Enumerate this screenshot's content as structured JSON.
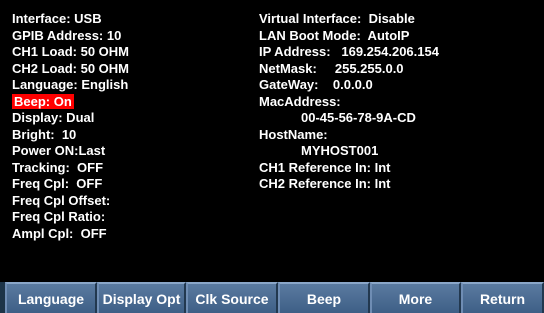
{
  "left_lines": [
    "Interface: USB",
    "GPIB Address: 10",
    "CH1 Load: 50 OHM",
    "CH2 Load: 50 OHM",
    "Language: English",
    "Beep: On",
    "Display: Dual",
    "Bright:  10",
    "Power ON:Last",
    "Tracking:  OFF",
    "Freq Cpl:  OFF",
    "Freq Cpl Offset:",
    "Freq Cpl Ratio:",
    "Ampl Cpl:  OFF"
  ],
  "right_lines": [
    "Virtual Interface:  Disable",
    "LAN Boot Mode:  AutoIP",
    "IP Address:   169.254.206.154",
    "NetMask:     255.255.0.0",
    "GateWay:    0.0.0.0",
    "MacAddress:",
    "00-45-56-78-9A-CD",
    "HostName:",
    "MYHOST001",
    "CH1 Reference In: Int",
    "CH2 Reference In: Int"
  ],
  "highlight_color": "#ff0000",
  "softkeys": [
    "Language",
    "Display Opt",
    "Clk Source",
    "Beep",
    "More",
    "Return"
  ]
}
